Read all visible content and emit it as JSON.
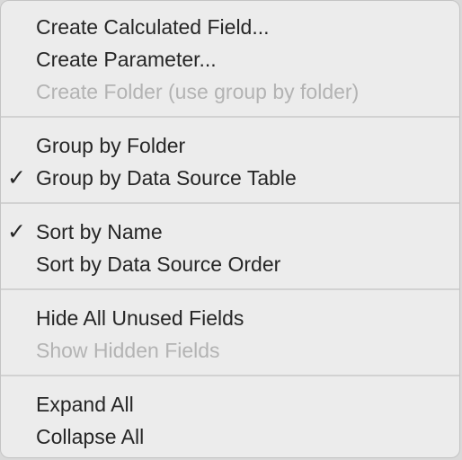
{
  "menu": {
    "items": [
      {
        "label": "Create Calculated Field...",
        "enabled": true,
        "checked": false
      },
      {
        "label": "Create Parameter...",
        "enabled": true,
        "checked": false
      },
      {
        "label": "Create Folder (use group by folder)",
        "enabled": false,
        "checked": false
      },
      {
        "label": "Group by Folder",
        "enabled": true,
        "checked": false
      },
      {
        "label": "Group by Data Source Table",
        "enabled": true,
        "checked": true
      },
      {
        "label": "Sort by Name",
        "enabled": true,
        "checked": true
      },
      {
        "label": "Sort by Data Source Order",
        "enabled": true,
        "checked": false
      },
      {
        "label": "Hide All Unused Fields",
        "enabled": true,
        "checked": false
      },
      {
        "label": "Show Hidden Fields",
        "enabled": false,
        "checked": false
      },
      {
        "label": "Expand All",
        "enabled": true,
        "checked": false
      },
      {
        "label": "Collapse All",
        "enabled": true,
        "checked": false
      }
    ],
    "checkmark_glyph": "✓",
    "colors": {
      "background": "#ececec",
      "text": "#262626",
      "disabled_text": "#b3b3b3",
      "separator": "#d2d2d2"
    }
  }
}
